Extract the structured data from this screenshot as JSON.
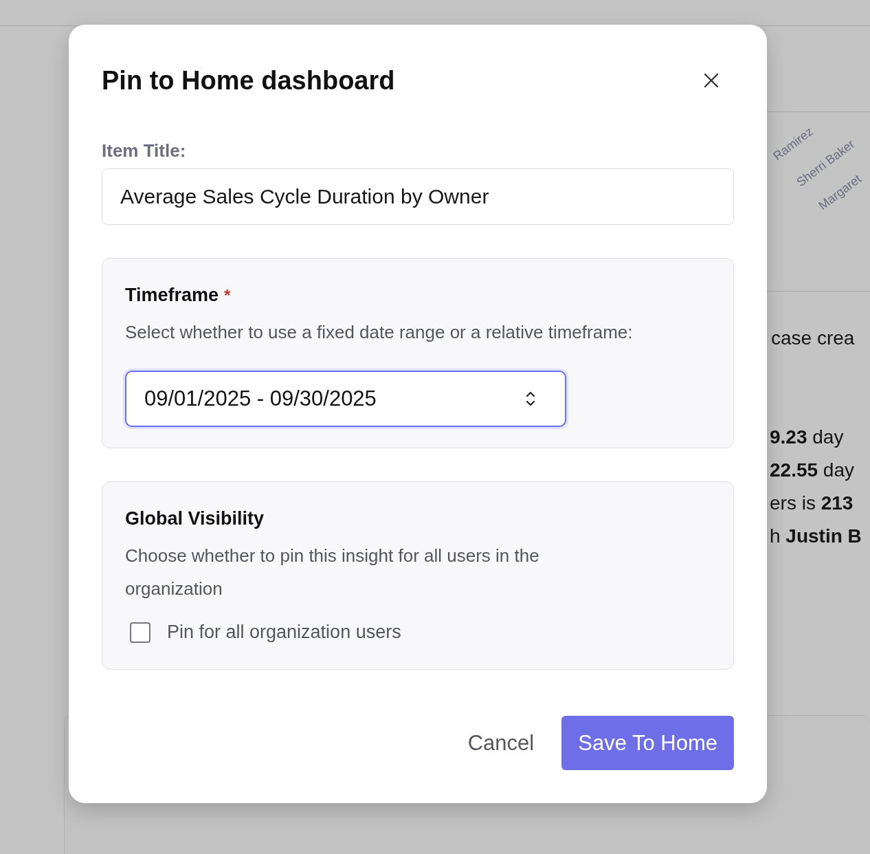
{
  "background": {
    "chart_labels": [
      "Ramirez",
      "Sherri Baker",
      "Margaret"
    ],
    "summary_lines": [
      "case crea",
      "**9.23** day",
      "**22.55** day",
      "ers is **213**",
      "h **Justin B**"
    ]
  },
  "dialog": {
    "title": "Pin to Home dashboard",
    "item_title": {
      "label": "Item Title:",
      "value": "Average Sales Cycle Duration by Owner"
    },
    "timeframe": {
      "title": "Timeframe",
      "required_mark": "*",
      "description": "Select whether to use a fixed date range or a relative timeframe:",
      "select_value": "09/01/2025 - 09/30/2025",
      "focused": true
    },
    "visibility": {
      "title": "Global Visibility",
      "description": "Choose whether to pin this insight for all users in the organization",
      "checkbox": {
        "label": "Pin for all organization users",
        "checked": false
      }
    },
    "buttons": [
      {
        "label": "Cancel",
        "kind": "secondary"
      },
      {
        "label": "Save To Home",
        "kind": "primary"
      }
    ]
  }
}
